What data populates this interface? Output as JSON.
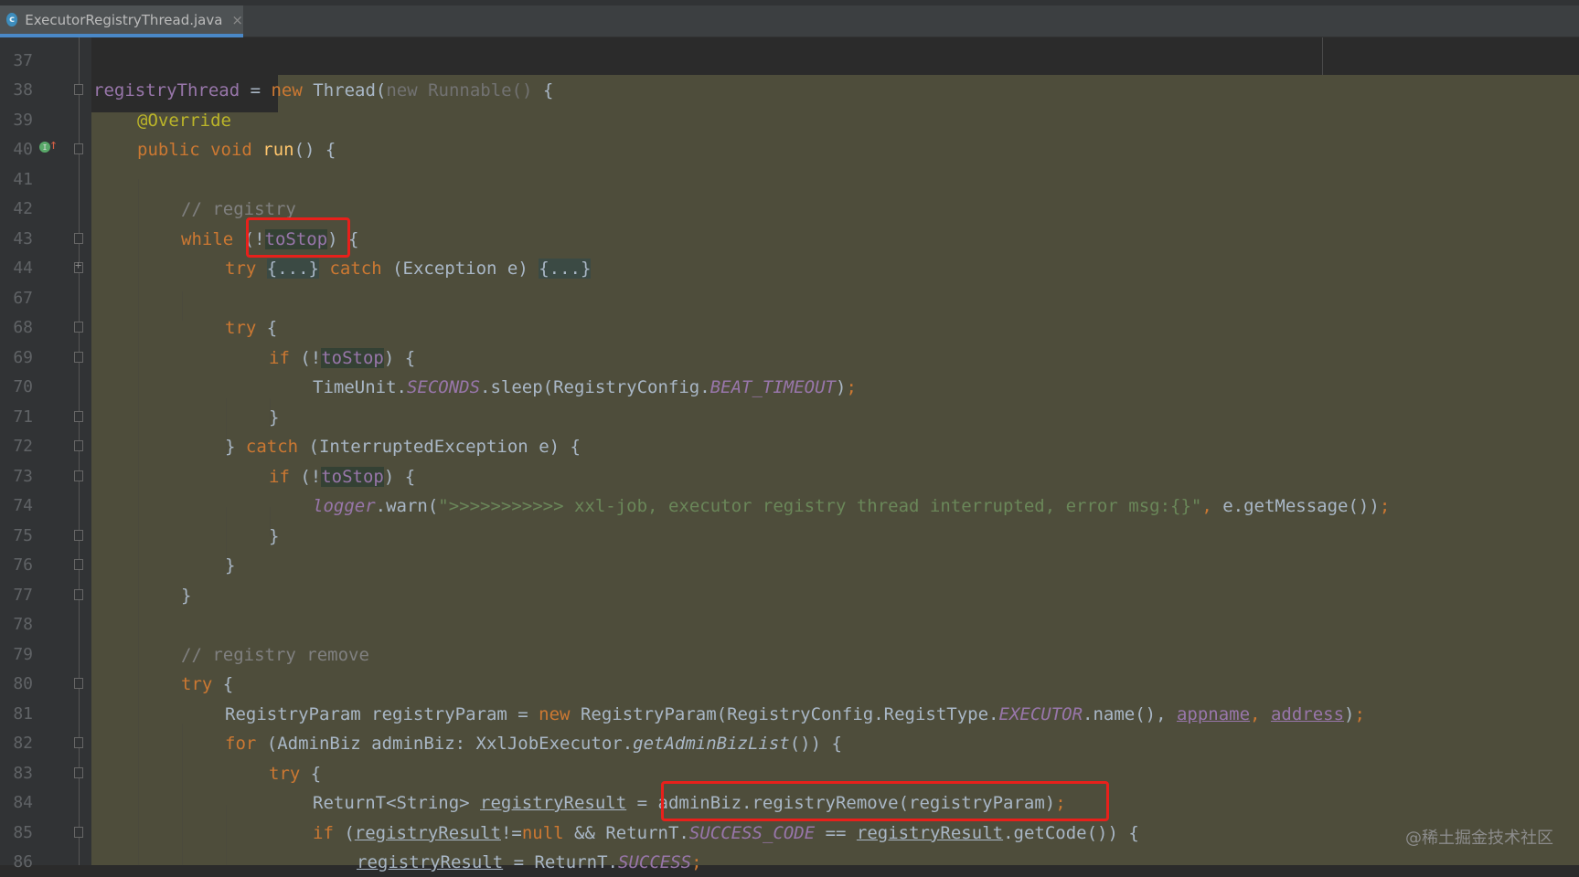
{
  "tab": {
    "file_name": "ExecutorRegistryThread.java",
    "icon_letter": "c",
    "close_glyph": "×"
  },
  "lines": [
    {
      "n": "37"
    },
    {
      "n": "38"
    },
    {
      "n": "39"
    },
    {
      "n": "40"
    },
    {
      "n": "41"
    },
    {
      "n": "42"
    },
    {
      "n": "43"
    },
    {
      "n": "44"
    },
    {
      "n": "67"
    },
    {
      "n": "68"
    },
    {
      "n": "69"
    },
    {
      "n": "70"
    },
    {
      "n": "71"
    },
    {
      "n": "72"
    },
    {
      "n": "73"
    },
    {
      "n": "74"
    },
    {
      "n": "75"
    },
    {
      "n": "76"
    },
    {
      "n": "77"
    },
    {
      "n": "78"
    },
    {
      "n": "79"
    },
    {
      "n": "80"
    },
    {
      "n": "81"
    },
    {
      "n": "82"
    },
    {
      "n": "83"
    },
    {
      "n": "84"
    },
    {
      "n": "85"
    },
    {
      "n": "86"
    }
  ],
  "code": {
    "l38": {
      "var": "registryThread",
      "eq": " = ",
      "new": "new",
      "cls": " Thread(",
      "new2": "new Runnable()",
      "tail": " {"
    },
    "l39": {
      "anno": "@Override"
    },
    "l40": {
      "kw": "public void",
      "fn": " run",
      "tail": "() {"
    },
    "l42": {
      "comment": "// registry"
    },
    "l43": {
      "kw": "while",
      "open": " (!",
      "field": "toStop",
      "close": ") {"
    },
    "l44": {
      "kw": "try",
      "sp": " ",
      "fold1": "{...}",
      "sp2": " ",
      "kw2": "catch",
      "mid": " (Exception e) ",
      "fold2": "{...}"
    },
    "l68": {
      "kw": "try",
      "tail": " {"
    },
    "l69": {
      "kw": "if",
      "open": " (!",
      "field": "toStop",
      "close": ") {"
    },
    "l70": {
      "a": "TimeUnit.",
      "f1": "SECONDS",
      "b": ".sleep(RegistryConfig.",
      "f2": "BEAT_TIMEOUT",
      "c": ")",
      "semi": ";"
    },
    "l71": {
      "t": "}"
    },
    "l72": {
      "a": "} ",
      "kw": "catch",
      "b": " (InterruptedException e) {"
    },
    "l73": {
      "kw": "if",
      "open": " (!",
      "field": "toStop",
      "close": ") {"
    },
    "l74": {
      "logger": "logger",
      "a": ".warn(",
      "str": "\">>>>>>>>>>> xxl-job, executor registry thread interrupted, error msg:{}\"",
      "comma": ",",
      "b": " e.getMessage())",
      "semi": ";"
    },
    "l75": {
      "t": "}"
    },
    "l76": {
      "t": "}"
    },
    "l77": {
      "t": "}"
    },
    "l79": {
      "comment": "// registry remove"
    },
    "l80": {
      "kw": "try",
      "tail": " {"
    },
    "l81": {
      "a": "RegistryParam registryParam = ",
      "kw": "new",
      "b": " RegistryParam(RegistryConfig.RegistType.",
      "f": "EXECUTOR",
      "c": ".name(), ",
      "v1": "appname",
      "comma": ", ",
      "v2": "address",
      "d": ")",
      "semi": ";"
    },
    "l82": {
      "kw": "for",
      "a": " (AdminBiz adminBiz: XxlJobExecutor.",
      "m": "getAdminBizList",
      "b": "()) {"
    },
    "l83": {
      "kw": "try",
      "tail": " {"
    },
    "l84": {
      "a": "ReturnT<String> ",
      "v": "registryResult",
      "b": " = ",
      "c": "adminBiz.registryRemove(registryParam)",
      "semi": ";"
    },
    "l85": {
      "kw": "if",
      "a": " (",
      "v": "registryResult",
      "b": "!=",
      "kw2": "null",
      "c": " && ReturnT.",
      "f": "SUCCESS_CODE",
      "d": " == ",
      "v2": "registryResult",
      "e": ".getCode()) {"
    },
    "l86": {
      "v": "registryResult",
      "a": " = ReturnT.",
      "f": "SUCCESS",
      "semi": ";"
    }
  },
  "watermark": "@稀土掘金技术社区",
  "colors": {
    "keyword": "#cc7832",
    "highlight_bg": "#4e4d3b",
    "annotation_box": "#e8201b",
    "tab_underline": "#4a88c7"
  }
}
